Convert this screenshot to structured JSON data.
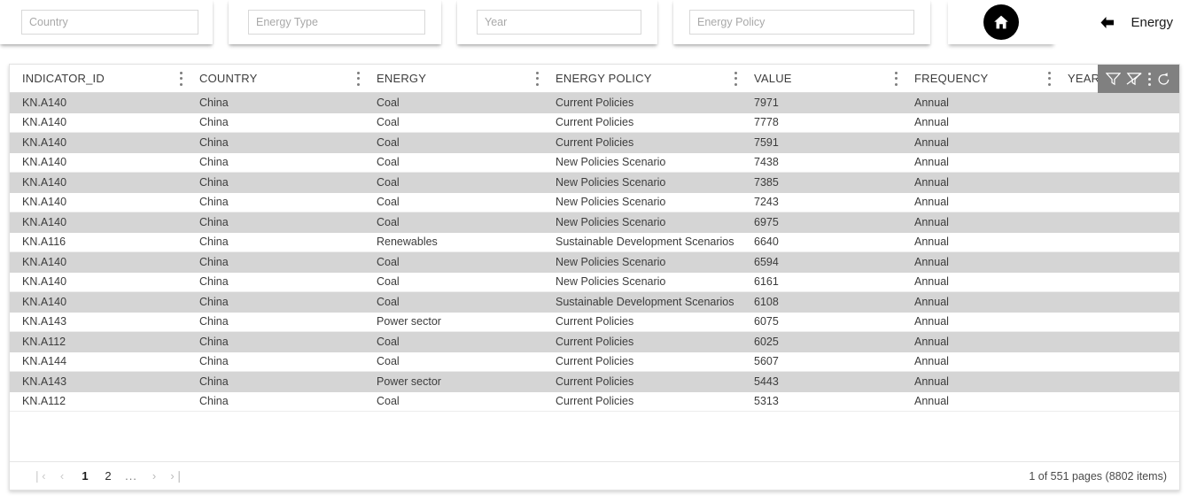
{
  "filters": [
    {
      "id": "country",
      "name": "country-filter-input",
      "placeholder": "Country",
      "value": ""
    },
    {
      "id": "energy-type",
      "name": "energy-type-filter-input",
      "placeholder": "Energy Type",
      "value": ""
    },
    {
      "id": "year",
      "name": "year-filter-input",
      "placeholder": "Year",
      "value": ""
    },
    {
      "id": "energy-policy",
      "name": "energy-policy-filter-input",
      "placeholder": "Energy Policy",
      "value": ""
    }
  ],
  "header": {
    "home_icon": "home-icon",
    "back_icon": "back-arrow-icon",
    "breadcrumb_label": "Energy"
  },
  "grid": {
    "columns": [
      {
        "key": "indicator_id",
        "label": "INDICATOR_ID"
      },
      {
        "key": "country",
        "label": "COUNTRY"
      },
      {
        "key": "energy",
        "label": "ENERGY"
      },
      {
        "key": "energy_policy",
        "label": "ENERGY POLICY"
      },
      {
        "key": "value",
        "label": "VALUE"
      },
      {
        "key": "frequency",
        "label": "FREQUENCY"
      },
      {
        "key": "year",
        "label": "YEAR"
      }
    ],
    "toolbar": {
      "filter_icon": "filter-icon",
      "clear_filter_icon": "clear-filter-icon",
      "menu_icon": "kebab-menu-icon",
      "reset_icon": "reset-icon"
    },
    "rows": [
      {
        "indicator_id": "KN.A140",
        "country": "China",
        "energy": "Coal",
        "energy_policy": "Current Policies",
        "value": "7971",
        "frequency": "Annual",
        "year": ""
      },
      {
        "indicator_id": "KN.A140",
        "country": "China",
        "energy": "Coal",
        "energy_policy": "Current Policies",
        "value": "7778",
        "frequency": "Annual",
        "year": ""
      },
      {
        "indicator_id": "KN.A140",
        "country": "China",
        "energy": "Coal",
        "energy_policy": "Current Policies",
        "value": "7591",
        "frequency": "Annual",
        "year": ""
      },
      {
        "indicator_id": "KN.A140",
        "country": "China",
        "energy": "Coal",
        "energy_policy": "New Policies Scenario",
        "value": "7438",
        "frequency": "Annual",
        "year": ""
      },
      {
        "indicator_id": "KN.A140",
        "country": "China",
        "energy": "Coal",
        "energy_policy": "New Policies Scenario",
        "value": "7385",
        "frequency": "Annual",
        "year": ""
      },
      {
        "indicator_id": "KN.A140",
        "country": "China",
        "energy": "Coal",
        "energy_policy": "New Policies Scenario",
        "value": "7243",
        "frequency": "Annual",
        "year": ""
      },
      {
        "indicator_id": "KN.A140",
        "country": "China",
        "energy": "Coal",
        "energy_policy": "New Policies Scenario",
        "value": "6975",
        "frequency": "Annual",
        "year": ""
      },
      {
        "indicator_id": "KN.A116",
        "country": "China",
        "energy": "Renewables",
        "energy_policy": "Sustainable Development Scenarios",
        "value": "6640",
        "frequency": "Annual",
        "year": ""
      },
      {
        "indicator_id": "KN.A140",
        "country": "China",
        "energy": "Coal",
        "energy_policy": "New Policies Scenario",
        "value": "6594",
        "frequency": "Annual",
        "year": ""
      },
      {
        "indicator_id": "KN.A140",
        "country": "China",
        "energy": "Coal",
        "energy_policy": "New Policies Scenario",
        "value": "6161",
        "frequency": "Annual",
        "year": ""
      },
      {
        "indicator_id": "KN.A140",
        "country": "China",
        "energy": "Coal",
        "energy_policy": "Sustainable Development Scenarios",
        "value": "6108",
        "frequency": "Annual",
        "year": ""
      },
      {
        "indicator_id": "KN.A143",
        "country": "China",
        "energy": "Power sector",
        "energy_policy": "Current Policies",
        "value": "6075",
        "frequency": "Annual",
        "year": ""
      },
      {
        "indicator_id": "KN.A112",
        "country": "China",
        "energy": "Coal",
        "energy_policy": "Current Policies",
        "value": "6025",
        "frequency": "Annual",
        "year": ""
      },
      {
        "indicator_id": "KN.A144",
        "country": "China",
        "energy": "Coal",
        "energy_policy": "Current Policies",
        "value": "5607",
        "frequency": "Annual",
        "year": ""
      },
      {
        "indicator_id": "KN.A143",
        "country": "China",
        "energy": "Power sector",
        "energy_policy": "Current Policies",
        "value": "5443",
        "frequency": "Annual",
        "year": ""
      },
      {
        "indicator_id": "KN.A112",
        "country": "China",
        "energy": "Coal",
        "energy_policy": "Current Policies",
        "value": "5313",
        "frequency": "Annual",
        "year": ""
      }
    ],
    "footer": {
      "pager": [
        {
          "kind": "first",
          "label": "❘‹",
          "state": "disabled"
        },
        {
          "kind": "prev",
          "label": "‹",
          "state": "disabled"
        },
        {
          "kind": "page",
          "label": "1",
          "state": "active"
        },
        {
          "kind": "page",
          "label": "2",
          "state": "normal"
        },
        {
          "kind": "ellipsis",
          "label": "...",
          "state": "normal"
        },
        {
          "kind": "next",
          "label": "›",
          "state": "muted"
        },
        {
          "kind": "last",
          "label": "›❘",
          "state": "muted"
        }
      ],
      "page_info": "1 of 551 pages (8802 items)"
    }
  },
  "colors": {
    "toolbar_bg": "#808080",
    "row_alt": "#d5d5d5",
    "text": "#3c3c3c"
  }
}
